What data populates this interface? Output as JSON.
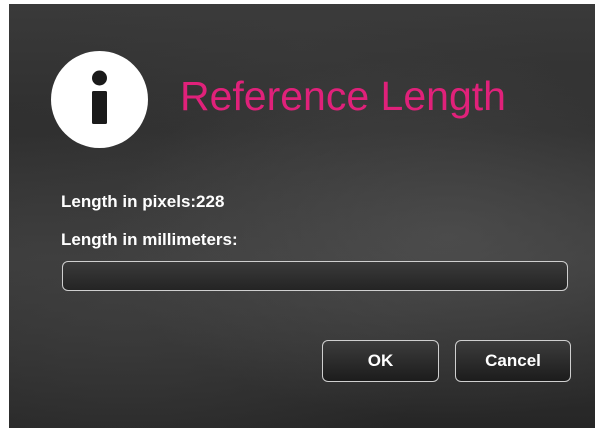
{
  "dialog": {
    "title": "Reference Length",
    "icon": "info-icon",
    "title_color": "#e0217a",
    "pixels_label": "Length in pixels:228",
    "millimeters_label": "Length in millimeters:",
    "millimeters_value": "",
    "ok_label": "OK",
    "cancel_label": "Cancel"
  }
}
